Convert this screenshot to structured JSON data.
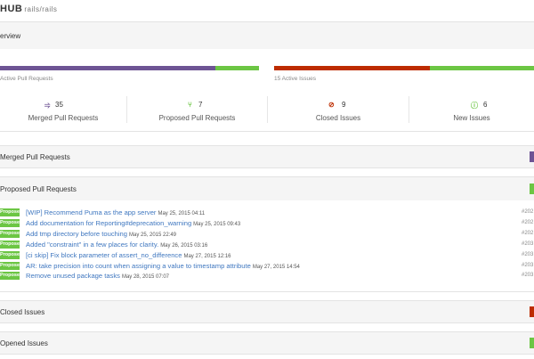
{
  "header": {
    "brand": "HUB",
    "repo": "rails/rails"
  },
  "overview": {
    "title": "erview"
  },
  "bars": {
    "pull_requests_label": "Active Pull Requests",
    "issues_label": "15 Active Issues",
    "pr_merged_fraction": 0.83,
    "issue_closed_fraction": 0.6,
    "colors": {
      "merged": "#6e5494",
      "proposed": "#6cc644",
      "closed": "#bd2c00",
      "new": "#6cc644"
    }
  },
  "stats": [
    {
      "count": "35",
      "label": "Merged Pull Requests",
      "icon": "merge-icon",
      "glyph": "⥤",
      "color": "#6e5494"
    },
    {
      "count": "7",
      "label": "Proposed Pull Requests",
      "icon": "pull-request-icon",
      "glyph": "⑂",
      "color": "#6cc644"
    },
    {
      "count": "9",
      "label": "Closed Issues",
      "icon": "closed-issue-icon",
      "glyph": "⊘",
      "color": "#bd2c00"
    },
    {
      "count": "6",
      "label": "New Issues",
      "icon": "new-issue-icon",
      "glyph": "ⓘ",
      "color": "#6cc644"
    }
  ],
  "sections": {
    "merged": "Merged Pull Requests",
    "proposed": "Proposed Pull Requests",
    "closed": "Closed Issues",
    "opened": "Opened Issues"
  },
  "proposed_items": [
    {
      "badge": "Proposed",
      "title": "[WIP] Recommend Puma as the app server",
      "date": "May 25, 2015 04:11",
      "ref": "#202"
    },
    {
      "badge": "Proposed",
      "title": "Add documentation for Reporting#deprecation_warning",
      "date": "May 25, 2015 09:43",
      "ref": "#202"
    },
    {
      "badge": "Proposed",
      "title": "Add tmp directory before touching",
      "date": "May 25, 2015 22:49",
      "ref": "#202"
    },
    {
      "badge": "Proposed",
      "title": "Added \"constraint\" in a few places for clarity.",
      "date": "May 26, 2015 03:16",
      "ref": "#203"
    },
    {
      "badge": "Proposed",
      "title": "[ci skip] Fix block parameter of assert_no_difference",
      "date": "May 27, 2015 12:16",
      "ref": "#203"
    },
    {
      "badge": "Proposed",
      "title": "AR: take precision into count when assigning a value to timestamp attribute",
      "date": "May 27, 2015 14:54",
      "ref": "#203"
    },
    {
      "badge": "Proposed",
      "title": "Remove unused package tasks",
      "date": "May 28, 2015 07:07",
      "ref": "#203"
    }
  ]
}
